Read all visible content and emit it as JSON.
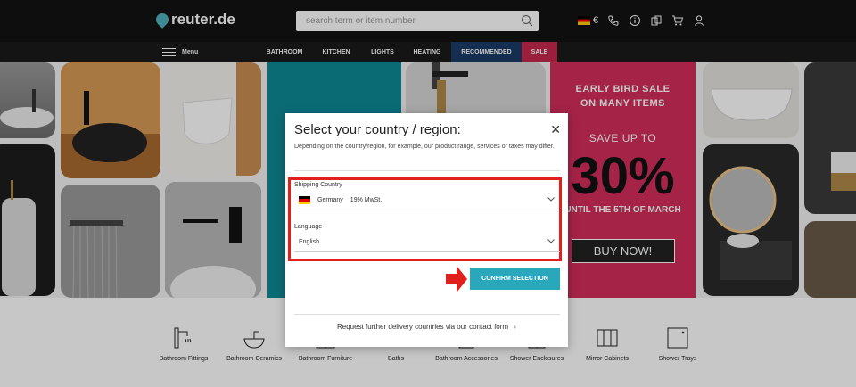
{
  "header": {
    "logo_text": "reuter.de",
    "search_placeholder": "search term or item number",
    "currency_symbol": "€",
    "icons": [
      "flag-de-icon",
      "phone-icon",
      "info-icon",
      "compare-icon",
      "cart-icon",
      "user-icon"
    ]
  },
  "nav": {
    "menu_label": "Menu",
    "items": [
      {
        "label": "BATHROOM"
      },
      {
        "label": "KITCHEN"
      },
      {
        "label": "LIGHTS"
      },
      {
        "label": "HEATING"
      },
      {
        "label": "RECOMMENDED",
        "bg": "#1b3a66"
      },
      {
        "label": "SALE",
        "bg": "#c4284f"
      }
    ]
  },
  "promo": {
    "line1": "EARLY BIRD SALE",
    "line2": "ON MANY ITEMS",
    "save_text": "SAVE UP TO",
    "percent": "30%",
    "until_text": "UNTIL THE 5TH OF MARCH",
    "buy_label": "BUY NOW!",
    "color": "#d22e5c"
  },
  "categories": [
    {
      "label": "Bathroom Fittings",
      "icon": "faucet-icon"
    },
    {
      "label": "Bathroom Ceramics",
      "icon": "washbasin-icon"
    },
    {
      "label": "Bathroom Furniture",
      "icon": "cabinet-icon"
    },
    {
      "label": "Baths",
      "icon": "bathtub-icon"
    },
    {
      "label": "Bathroom Accessories",
      "icon": "accessories-icon"
    },
    {
      "label": "Shower Enclosures",
      "icon": "shower-enclosure-icon"
    },
    {
      "label": "Mirror Cabinets",
      "icon": "mirror-cabinet-icon"
    },
    {
      "label": "Shower Trays",
      "icon": "shower-tray-icon"
    }
  ],
  "modal": {
    "title": "Select your country / region:",
    "description": "Depending on the country/region, for example, our product range, services or taxes may differ.",
    "shipping_label": "Shipping Country",
    "shipping_country": "Germany",
    "shipping_vat": "19% MwSt.",
    "language_label": "Language",
    "language_value": "English",
    "confirm_label": "CONFIRM SELECTION",
    "request_text": "Request further delivery countries via our contact form",
    "accent_color": "#2aa8bb",
    "highlight_color": "#e0201d"
  }
}
